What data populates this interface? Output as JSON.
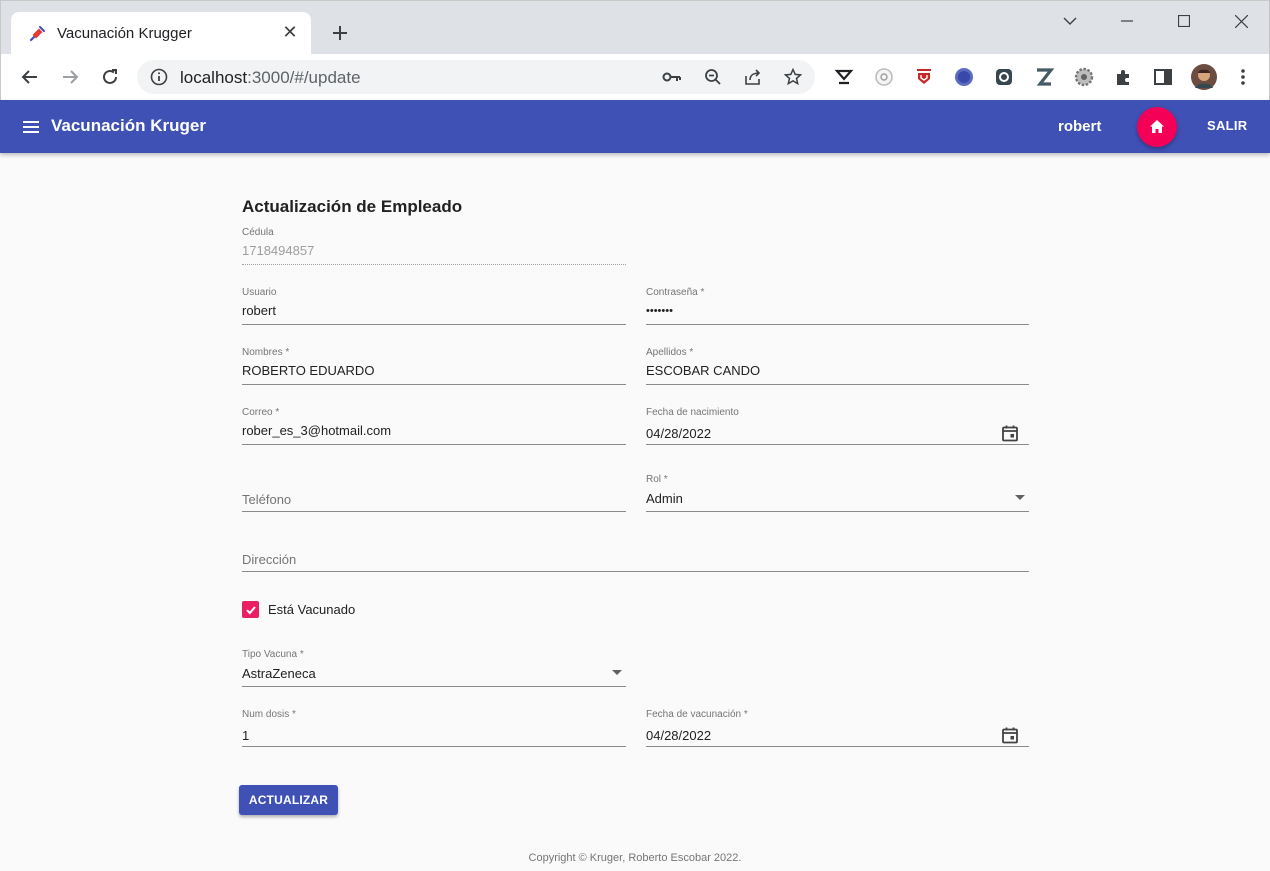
{
  "browser": {
    "tab_title": "Vacunación Krugger",
    "url_host": "localhost",
    "url_path": ":3000/#/update"
  },
  "appbar": {
    "brand": "Vacunación Kruger",
    "user": "robert",
    "logout_label": "SALIR",
    "color": "#3f51b5",
    "accent": "#f50057"
  },
  "form": {
    "title": "Actualización de Empleado",
    "cedula": {
      "label": "Cédula",
      "value": "1718494857"
    },
    "usuario": {
      "label": "Usuario",
      "value": "robert"
    },
    "contrasena": {
      "label": "Contraseña *",
      "value": "•••••••"
    },
    "nombres": {
      "label": "Nombres *",
      "value": "ROBERTO EDUARDO"
    },
    "apellidos": {
      "label": "Apellidos *",
      "value": "ESCOBAR CANDO"
    },
    "correo": {
      "label": "Correo *",
      "value": "rober_es_3@hotmail.com"
    },
    "fecha_nacimiento": {
      "label": "Fecha de nacimiento",
      "value": "04/28/2022"
    },
    "telefono": {
      "placeholder": "Teléfono"
    },
    "rol": {
      "label": "Rol *",
      "value": "Admin"
    },
    "direccion": {
      "placeholder": "Dirección"
    },
    "vacunado": {
      "label": "Está Vacunado",
      "checked": true
    },
    "tipo_vacuna": {
      "label": "Tipo Vacuna *",
      "value": "AstraZeneca"
    },
    "num_dosis": {
      "label": "Num dosis *",
      "value": "1"
    },
    "fecha_vacunacion": {
      "label": "Fecha de vacunación *",
      "value": "04/28/2022"
    },
    "submit_label": "ACTUALIZAR"
  },
  "footer": {
    "text": "Copyright © Kruger, Roberto Escobar 2022."
  }
}
